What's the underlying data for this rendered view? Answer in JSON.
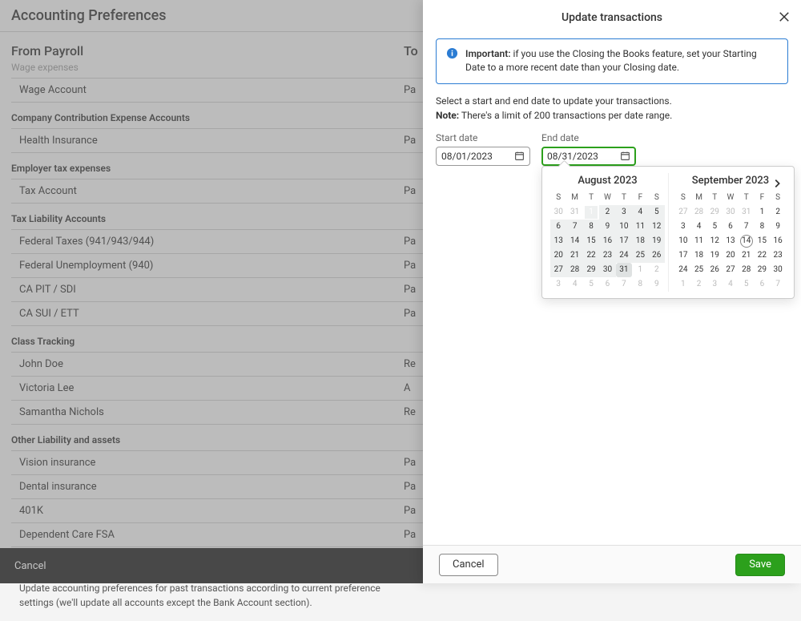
{
  "bg": {
    "header": "Accounting Preferences",
    "col_from": "From Payroll",
    "col_to": "To",
    "sections": [
      {
        "title": "Wage expenses",
        "rows": [
          {
            "name": "Wage Account",
            "to": "Pa"
          }
        ]
      },
      {
        "title": "Company Contribution Expense Accounts",
        "rows": [
          {
            "name": "Health Insurance",
            "to": "Pa"
          }
        ]
      },
      {
        "title": "Employer tax expenses",
        "rows": [
          {
            "name": "Tax Account",
            "to": "Pa"
          }
        ]
      },
      {
        "title": "Tax Liability Accounts",
        "rows": [
          {
            "name": "Federal Taxes (941/943/944)",
            "to": "Pa"
          },
          {
            "name": "Federal Unemployment (940)",
            "to": "Pa"
          },
          {
            "name": "CA PIT / SDI",
            "to": "Pa"
          },
          {
            "name": "CA SUI / ETT",
            "to": "Pa"
          }
        ]
      },
      {
        "title": "Class Tracking",
        "rows": [
          {
            "name": "John Doe",
            "to": "Re"
          },
          {
            "name": "Victoria Lee",
            "to": "A"
          },
          {
            "name": "Samantha Nichols",
            "to": "Re"
          }
        ]
      },
      {
        "title": "Other Liability and assets",
        "rows": [
          {
            "name": "Vision insurance",
            "to": "Pa"
          },
          {
            "name": "Dental insurance",
            "to": "Pa"
          },
          {
            "name": "401K",
            "to": "Pa"
          },
          {
            "name": "Dependent Care FSA",
            "to": "Pa"
          }
        ]
      }
    ],
    "update": {
      "title": "Update transactions",
      "desc": "Update accounting preferences for past transactions according to current preference settings (we'll update all accounts except the Bank Account section)."
    },
    "footer_cancel": "Cancel"
  },
  "panel": {
    "title": "Update transactions",
    "info_strong": "Important:",
    "info_rest": " if you use the Closing the Books feature, set your Starting Date to a more recent date than your Closing date.",
    "instr": "Select a start and end date to update your transactions.",
    "note_label": "Note:",
    "note_rest": " There's a limit of 200 transactions per date range.",
    "start_label": "Start date",
    "start_value": "08/01/2023",
    "end_label": "End date",
    "end_value": "08/31/2023",
    "cancel": "Cancel",
    "save": "Save"
  },
  "cal": {
    "dow": [
      "S",
      "M",
      "T",
      "W",
      "T",
      "F",
      "S"
    ],
    "month1": {
      "label": "August 2023",
      "weeks": [
        [
          {
            "d": "30",
            "m": 1
          },
          {
            "d": "31",
            "m": 1
          },
          {
            "d": "1",
            "start": 1,
            "r": 1
          },
          {
            "d": "2",
            "r": 1
          },
          {
            "d": "3",
            "r": 1
          },
          {
            "d": "4",
            "r": 1
          },
          {
            "d": "5",
            "r": 1
          }
        ],
        [
          {
            "d": "6",
            "r": 1
          },
          {
            "d": "7",
            "r": 1
          },
          {
            "d": "8",
            "r": 1
          },
          {
            "d": "9",
            "r": 1
          },
          {
            "d": "10",
            "r": 1
          },
          {
            "d": "11",
            "r": 1
          },
          {
            "d": "12",
            "r": 1
          }
        ],
        [
          {
            "d": "13",
            "r": 1
          },
          {
            "d": "14",
            "r": 1
          },
          {
            "d": "15",
            "r": 1
          },
          {
            "d": "16",
            "r": 1
          },
          {
            "d": "17",
            "r": 1
          },
          {
            "d": "18",
            "r": 1
          },
          {
            "d": "19",
            "r": 1
          }
        ],
        [
          {
            "d": "20",
            "r": 1
          },
          {
            "d": "21",
            "r": 1
          },
          {
            "d": "22",
            "r": 1
          },
          {
            "d": "23",
            "r": 1
          },
          {
            "d": "24",
            "r": 1
          },
          {
            "d": "25",
            "r": 1
          },
          {
            "d": "26",
            "r": 1
          }
        ],
        [
          {
            "d": "27",
            "r": 1
          },
          {
            "d": "28",
            "r": 1
          },
          {
            "d": "29",
            "r": 1
          },
          {
            "d": "30",
            "r": 1
          },
          {
            "d": "31",
            "end": 1
          },
          {
            "d": "1",
            "m": 1
          },
          {
            "d": "2",
            "m": 1
          }
        ],
        [
          {
            "d": "3",
            "m": 1
          },
          {
            "d": "4",
            "m": 1
          },
          {
            "d": "5",
            "m": 1
          },
          {
            "d": "6",
            "m": 1
          },
          {
            "d": "7",
            "m": 1
          },
          {
            "d": "8",
            "m": 1
          },
          {
            "d": "9",
            "m": 1
          }
        ]
      ]
    },
    "month2": {
      "label": "September 2023",
      "weeks": [
        [
          {
            "d": "27",
            "m": 1
          },
          {
            "d": "28",
            "m": 1
          },
          {
            "d": "29",
            "m": 1
          },
          {
            "d": "30",
            "m": 1
          },
          {
            "d": "31",
            "m": 1
          },
          {
            "d": "1"
          },
          {
            "d": "2"
          }
        ],
        [
          {
            "d": "3"
          },
          {
            "d": "4"
          },
          {
            "d": "5"
          },
          {
            "d": "6"
          },
          {
            "d": "7"
          },
          {
            "d": "8"
          },
          {
            "d": "9"
          }
        ],
        [
          {
            "d": "10"
          },
          {
            "d": "11"
          },
          {
            "d": "12"
          },
          {
            "d": "13"
          },
          {
            "d": "14",
            "today": 1
          },
          {
            "d": "15"
          },
          {
            "d": "16"
          }
        ],
        [
          {
            "d": "17"
          },
          {
            "d": "18"
          },
          {
            "d": "19"
          },
          {
            "d": "20"
          },
          {
            "d": "21"
          },
          {
            "d": "22"
          },
          {
            "d": "23"
          }
        ],
        [
          {
            "d": "24"
          },
          {
            "d": "25"
          },
          {
            "d": "26"
          },
          {
            "d": "27"
          },
          {
            "d": "28"
          },
          {
            "d": "29"
          },
          {
            "d": "30"
          }
        ],
        [
          {
            "d": "1",
            "m": 1
          },
          {
            "d": "2",
            "m": 1
          },
          {
            "d": "3",
            "m": 1
          },
          {
            "d": "4",
            "m": 1
          },
          {
            "d": "5",
            "m": 1
          },
          {
            "d": "6",
            "m": 1
          },
          {
            "d": "7",
            "m": 1
          }
        ]
      ]
    }
  }
}
